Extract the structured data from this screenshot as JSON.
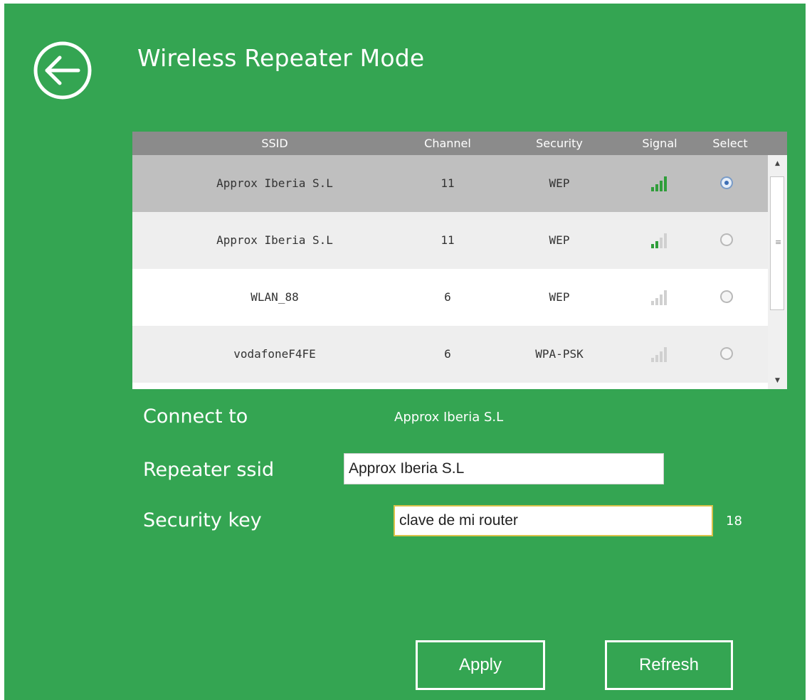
{
  "header": {
    "title": "Wireless Repeater Mode",
    "back_icon": "arrow-left-circle-icon"
  },
  "table": {
    "columns": [
      "SSID",
      "Channel",
      "Security",
      "Signal",
      "Select"
    ],
    "rows": [
      {
        "ssid": "Approx Iberia S.L",
        "channel": "11",
        "security": "WEP",
        "signal_bars": 4,
        "selected": true
      },
      {
        "ssid": "Approx Iberia S.L",
        "channel": "11",
        "security": "WEP",
        "signal_bars": 2,
        "selected": false
      },
      {
        "ssid": "WLAN_88",
        "channel": "6",
        "security": "WEP",
        "signal_bars": 0,
        "selected": false
      },
      {
        "ssid": "vodafoneF4FE",
        "channel": "6",
        "security": "WPA-PSK",
        "signal_bars": 0,
        "selected": false
      }
    ]
  },
  "form": {
    "connect_label": "Connect to",
    "connect_value": "Approx Iberia S.L",
    "repeater_label": "Repeater ssid",
    "repeater_value": "Approx Iberia S.L",
    "key_label": "Security key",
    "key_value": "clave de mi router",
    "key_length": "18"
  },
  "buttons": {
    "apply": "Apply",
    "refresh": "Refresh"
  },
  "colors": {
    "background": "#34a552",
    "header_row": "#8b8b8b",
    "signal_on": "#2f9e3a",
    "signal_off": "#d0d0d0"
  }
}
